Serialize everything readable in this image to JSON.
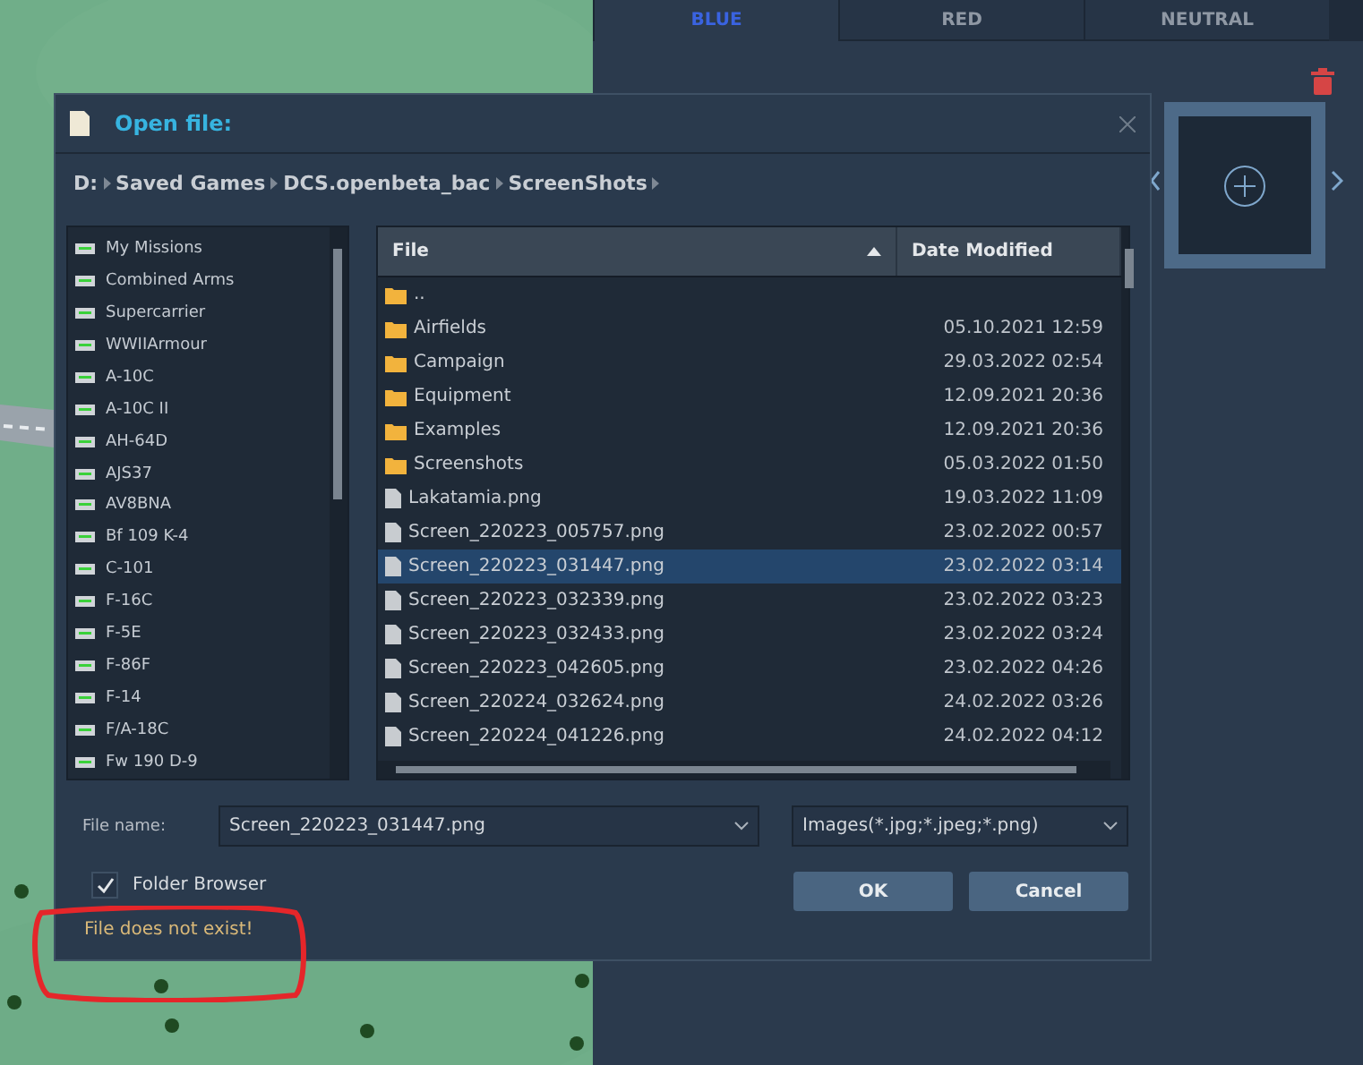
{
  "side_tabs": [
    {
      "label": "BLUE",
      "selected": true
    },
    {
      "label": "RED",
      "selected": false
    },
    {
      "label": "NEUTRAL",
      "selected": false
    }
  ],
  "dialog": {
    "title": "Open file:",
    "path": [
      "D:",
      "Saved Games",
      "DCS.openbeta_bac",
      "ScreenShots"
    ],
    "folders": [
      "My Missions",
      "Combined Arms",
      "Supercarrier",
      "WWIIArmour",
      "A-10C",
      "A-10C II",
      "AH-64D",
      "AJS37",
      "AV8BNA",
      "Bf 109 K-4",
      "C-101",
      "F-16C",
      "F-5E",
      "F-86F",
      "F-14",
      "F/A-18C",
      "Fw 190 D-9"
    ],
    "table": {
      "columns": [
        {
          "label": "File",
          "sorted": true
        },
        {
          "label": "Date Modified",
          "sorted": false
        }
      ],
      "rows": [
        {
          "kind": "folder",
          "name": "..",
          "selected": false
        },
        {
          "kind": "folder",
          "name": "Airfields",
          "date": "05.10.2021 12:59",
          "selected": false
        },
        {
          "kind": "folder",
          "name": "Campaign",
          "date": "29.03.2022 02:54",
          "selected": false
        },
        {
          "kind": "folder",
          "name": "Equipment",
          "date": "12.09.2021 20:36",
          "selected": false
        },
        {
          "kind": "folder",
          "name": "Examples",
          "date": "12.09.2021 20:36",
          "selected": false
        },
        {
          "kind": "folder",
          "name": "Screenshots",
          "date": "05.03.2022 01:50",
          "selected": false
        },
        {
          "kind": "file",
          "name": "Lakatamia.png",
          "date": "19.03.2022 11:09",
          "selected": false
        },
        {
          "kind": "file",
          "name": "Screen_220223_005757.png",
          "date": "23.02.2022 00:57",
          "selected": false
        },
        {
          "kind": "file",
          "name": "Screen_220223_031447.png",
          "date": "23.02.2022 03:14",
          "selected": true
        },
        {
          "kind": "file",
          "name": "Screen_220223_032339.png",
          "date": "23.02.2022 03:23",
          "selected": false
        },
        {
          "kind": "file",
          "name": "Screen_220223_032433.png",
          "date": "23.02.2022 03:24",
          "selected": false
        },
        {
          "kind": "file",
          "name": "Screen_220223_042605.png",
          "date": "23.02.2022 04:26",
          "selected": false
        },
        {
          "kind": "file",
          "name": "Screen_220224_032624.png",
          "date": "24.02.2022 03:26",
          "selected": false
        },
        {
          "kind": "file",
          "name": "Screen_220224_041226.png",
          "date": "24.02.2022 04:12",
          "selected": false
        }
      ]
    },
    "file_name": {
      "label": "File name:",
      "value": "Screen_220223_031447.png"
    },
    "file_type": {
      "value": "Images(*.jpg;*.jpeg;*.png)"
    },
    "folder_browser": {
      "label": "Folder Browser",
      "checked": true
    },
    "buttons": [
      "OK",
      "Cancel"
    ],
    "error": "File does not exist!"
  }
}
